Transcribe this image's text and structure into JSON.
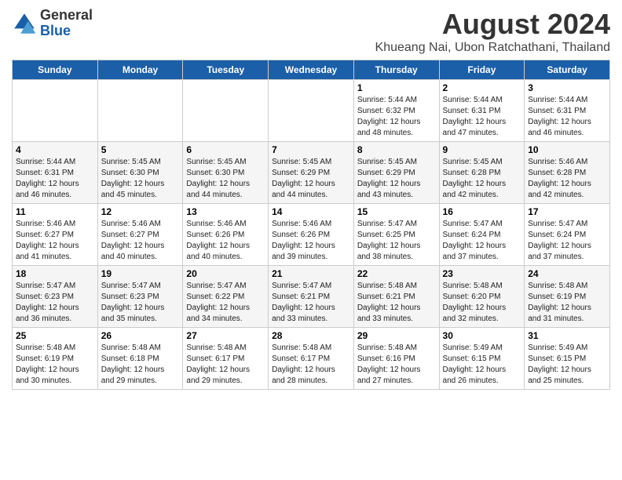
{
  "header": {
    "logo_general": "General",
    "logo_blue": "Blue",
    "main_title": "August 2024",
    "subtitle": "Khueang Nai, Ubon Ratchathani, Thailand"
  },
  "weekdays": [
    "Sunday",
    "Monday",
    "Tuesday",
    "Wednesday",
    "Thursday",
    "Friday",
    "Saturday"
  ],
  "weeks": [
    [
      {
        "day": "",
        "info": ""
      },
      {
        "day": "",
        "info": ""
      },
      {
        "day": "",
        "info": ""
      },
      {
        "day": "",
        "info": ""
      },
      {
        "day": "1",
        "info": "Sunrise: 5:44 AM\nSunset: 6:32 PM\nDaylight: 12 hours\nand 48 minutes."
      },
      {
        "day": "2",
        "info": "Sunrise: 5:44 AM\nSunset: 6:31 PM\nDaylight: 12 hours\nand 47 minutes."
      },
      {
        "day": "3",
        "info": "Sunrise: 5:44 AM\nSunset: 6:31 PM\nDaylight: 12 hours\nand 46 minutes."
      }
    ],
    [
      {
        "day": "4",
        "info": "Sunrise: 5:44 AM\nSunset: 6:31 PM\nDaylight: 12 hours\nand 46 minutes."
      },
      {
        "day": "5",
        "info": "Sunrise: 5:45 AM\nSunset: 6:30 PM\nDaylight: 12 hours\nand 45 minutes."
      },
      {
        "day": "6",
        "info": "Sunrise: 5:45 AM\nSunset: 6:30 PM\nDaylight: 12 hours\nand 44 minutes."
      },
      {
        "day": "7",
        "info": "Sunrise: 5:45 AM\nSunset: 6:29 PM\nDaylight: 12 hours\nand 44 minutes."
      },
      {
        "day": "8",
        "info": "Sunrise: 5:45 AM\nSunset: 6:29 PM\nDaylight: 12 hours\nand 43 minutes."
      },
      {
        "day": "9",
        "info": "Sunrise: 5:45 AM\nSunset: 6:28 PM\nDaylight: 12 hours\nand 42 minutes."
      },
      {
        "day": "10",
        "info": "Sunrise: 5:46 AM\nSunset: 6:28 PM\nDaylight: 12 hours\nand 42 minutes."
      }
    ],
    [
      {
        "day": "11",
        "info": "Sunrise: 5:46 AM\nSunset: 6:27 PM\nDaylight: 12 hours\nand 41 minutes."
      },
      {
        "day": "12",
        "info": "Sunrise: 5:46 AM\nSunset: 6:27 PM\nDaylight: 12 hours\nand 40 minutes."
      },
      {
        "day": "13",
        "info": "Sunrise: 5:46 AM\nSunset: 6:26 PM\nDaylight: 12 hours\nand 40 minutes."
      },
      {
        "day": "14",
        "info": "Sunrise: 5:46 AM\nSunset: 6:26 PM\nDaylight: 12 hours\nand 39 minutes."
      },
      {
        "day": "15",
        "info": "Sunrise: 5:47 AM\nSunset: 6:25 PM\nDaylight: 12 hours\nand 38 minutes."
      },
      {
        "day": "16",
        "info": "Sunrise: 5:47 AM\nSunset: 6:24 PM\nDaylight: 12 hours\nand 37 minutes."
      },
      {
        "day": "17",
        "info": "Sunrise: 5:47 AM\nSunset: 6:24 PM\nDaylight: 12 hours\nand 37 minutes."
      }
    ],
    [
      {
        "day": "18",
        "info": "Sunrise: 5:47 AM\nSunset: 6:23 PM\nDaylight: 12 hours\nand 36 minutes."
      },
      {
        "day": "19",
        "info": "Sunrise: 5:47 AM\nSunset: 6:23 PM\nDaylight: 12 hours\nand 35 minutes."
      },
      {
        "day": "20",
        "info": "Sunrise: 5:47 AM\nSunset: 6:22 PM\nDaylight: 12 hours\nand 34 minutes."
      },
      {
        "day": "21",
        "info": "Sunrise: 5:47 AM\nSunset: 6:21 PM\nDaylight: 12 hours\nand 33 minutes."
      },
      {
        "day": "22",
        "info": "Sunrise: 5:48 AM\nSunset: 6:21 PM\nDaylight: 12 hours\nand 33 minutes."
      },
      {
        "day": "23",
        "info": "Sunrise: 5:48 AM\nSunset: 6:20 PM\nDaylight: 12 hours\nand 32 minutes."
      },
      {
        "day": "24",
        "info": "Sunrise: 5:48 AM\nSunset: 6:19 PM\nDaylight: 12 hours\nand 31 minutes."
      }
    ],
    [
      {
        "day": "25",
        "info": "Sunrise: 5:48 AM\nSunset: 6:19 PM\nDaylight: 12 hours\nand 30 minutes."
      },
      {
        "day": "26",
        "info": "Sunrise: 5:48 AM\nSunset: 6:18 PM\nDaylight: 12 hours\nand 29 minutes."
      },
      {
        "day": "27",
        "info": "Sunrise: 5:48 AM\nSunset: 6:17 PM\nDaylight: 12 hours\nand 29 minutes."
      },
      {
        "day": "28",
        "info": "Sunrise: 5:48 AM\nSunset: 6:17 PM\nDaylight: 12 hours\nand 28 minutes."
      },
      {
        "day": "29",
        "info": "Sunrise: 5:48 AM\nSunset: 6:16 PM\nDaylight: 12 hours\nand 27 minutes."
      },
      {
        "day": "30",
        "info": "Sunrise: 5:49 AM\nSunset: 6:15 PM\nDaylight: 12 hours\nand 26 minutes."
      },
      {
        "day": "31",
        "info": "Sunrise: 5:49 AM\nSunset: 6:15 PM\nDaylight: 12 hours\nand 25 minutes."
      }
    ]
  ]
}
